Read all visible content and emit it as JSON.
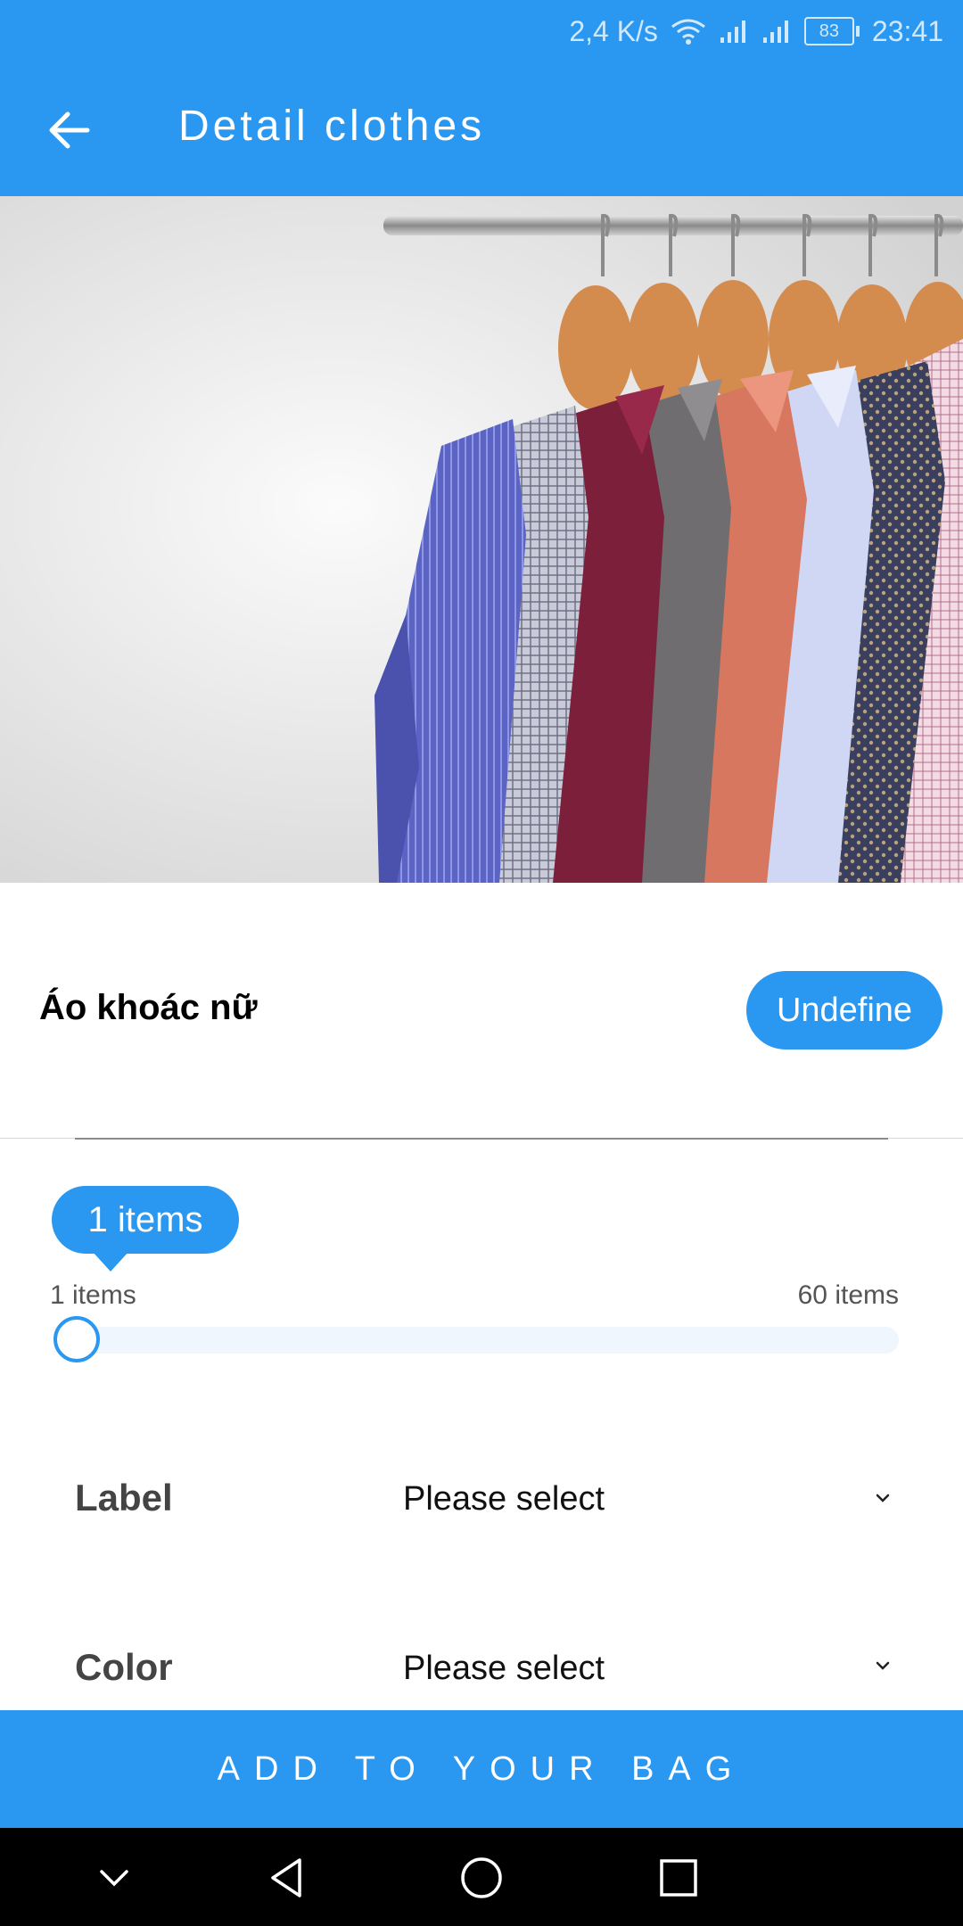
{
  "status": {
    "speed": "2,4 K/s",
    "battery": "83",
    "time": "23:41"
  },
  "header": {
    "title": "Detail clothes"
  },
  "product": {
    "name": "Áo khoác nữ",
    "badge": "Undefine"
  },
  "slider": {
    "value_label": "1 items",
    "min_label": "1 items",
    "max_label": "60 items",
    "value": 1,
    "min": 1,
    "max": 60
  },
  "fields": [
    {
      "label": "Label",
      "value": "Please select"
    },
    {
      "label": "Color",
      "value": "Please select"
    }
  ],
  "cta": {
    "label": "ADD TO YOUR BAG"
  },
  "icons": {
    "back": "arrow-left-icon",
    "chevron": "chevron-down-icon",
    "nav_back": "triangle-back-icon",
    "nav_home": "circle-home-icon",
    "nav_recent": "square-recent-icon",
    "nav_hide": "chevron-down-icon"
  },
  "colors": {
    "primary": "#2a98f0",
    "white": "#ffffff",
    "nav": "#000000"
  }
}
